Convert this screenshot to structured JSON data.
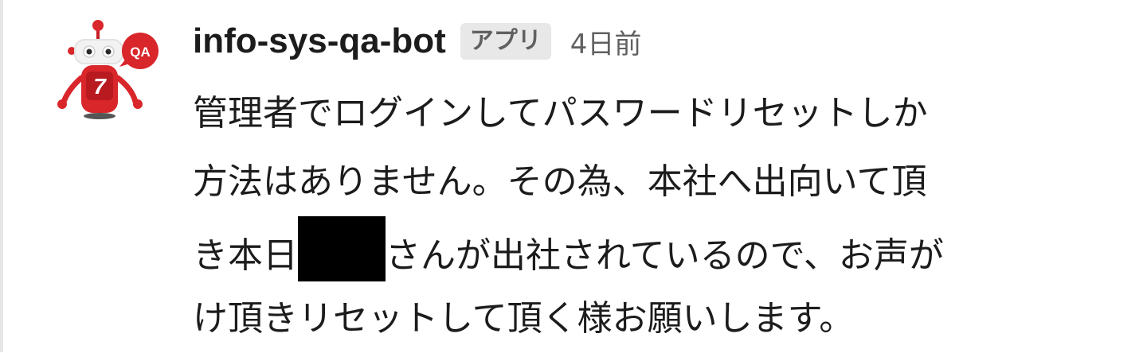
{
  "message": {
    "sender": "info-sys-qa-bot",
    "badge": "アプリ",
    "timestamp": "4日前",
    "avatar": {
      "icon": "robot-icon",
      "bubble_text": "QA",
      "chest_text": "7",
      "accent_color": "#d8262b"
    },
    "lines": [
      {
        "text": "管理者でログインしてパスワードリセットしか"
      },
      {
        "text": "方法はありません。その為、本社へ出向いて頂"
      },
      {
        "before": "き本日",
        "after": "さんが出社されているので、お声が"
      },
      {
        "text": "け頂きリセットして頂く様お願いします。"
      }
    ]
  }
}
